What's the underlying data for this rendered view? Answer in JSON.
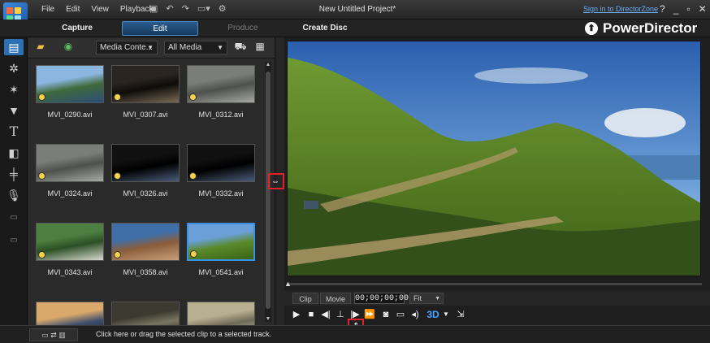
{
  "app": {
    "window_title": "New Untitled Project*",
    "brand": "PowerDirector",
    "sign_in": "Sign in to DirectorZone",
    "window_controls": [
      "?",
      "_",
      "▫",
      "✕"
    ]
  },
  "menu": [
    "File",
    "Edit",
    "View",
    "Playback"
  ],
  "modes": [
    {
      "label": "Capture",
      "state": "normal"
    },
    {
      "label": "Edit",
      "state": "active"
    },
    {
      "label": "Produce",
      "state": "disabled"
    },
    {
      "label": "Create Disc",
      "state": "normal"
    }
  ],
  "sidebar": {
    "tools": [
      "media-room-icon",
      "effects-icon",
      "pip-objects-icon",
      "particle-icon",
      "title-icon",
      "transition-icon",
      "audio-mixing-icon",
      "voiceover-icon",
      "chapter-icon",
      "subtitle-icon"
    ]
  },
  "library": {
    "content_filter": "Media Conte...",
    "media_filter": "All Media",
    "clips": [
      {
        "name": "MVI_0290.avi",
        "theme": "coast"
      },
      {
        "name": "MVI_0307.avi",
        "theme": "crowd"
      },
      {
        "name": "MVI_0312.avi",
        "theme": "rock"
      },
      {
        "name": "MVI_0324.avi",
        "theme": "rock"
      },
      {
        "name": "MVI_0326.avi",
        "theme": "cave"
      },
      {
        "name": "MVI_0332.avi",
        "theme": "cave"
      },
      {
        "name": "MVI_0343.avi",
        "theme": "birds"
      },
      {
        "name": "MVI_0358.avi",
        "theme": "cliff"
      },
      {
        "name": "MVI_0541.avi",
        "theme": "hills",
        "selected": true
      },
      {
        "name": "",
        "theme": "sunset"
      },
      {
        "name": "",
        "theme": "tunnel"
      },
      {
        "name": "",
        "theme": "tree"
      }
    ]
  },
  "preview": {
    "clip_tab": "Clip",
    "movie_tab": "Movie",
    "timecode": "00;00;00;00",
    "fit": "Fit",
    "three_d": "3D"
  },
  "status": {
    "message": "Click here or drag the selected clip to a selected track."
  },
  "colors": {
    "accent": "#2d6fb3",
    "highlight": "#e0202a",
    "link": "#6cb0ff"
  }
}
